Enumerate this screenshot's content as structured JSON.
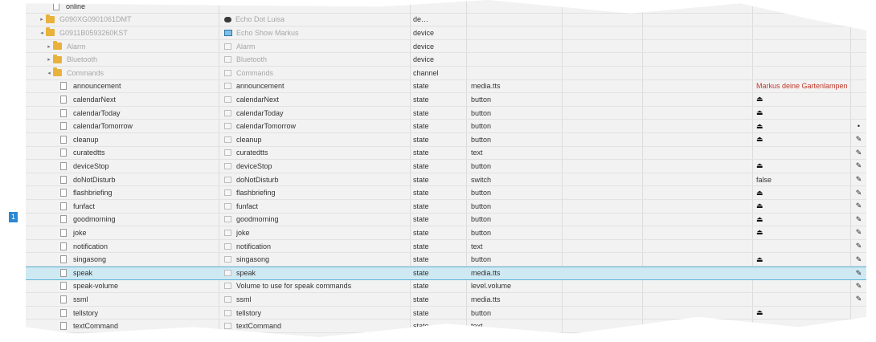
{
  "pagination": {
    "current_page": "1"
  },
  "rows": [
    {
      "indent": 2,
      "toggle": "",
      "icon": "file",
      "id": "online",
      "name": "",
      "type": "",
      "role": "",
      "value": "",
      "action": "",
      "dim": false
    },
    {
      "indent": 1,
      "toggle": "▸",
      "icon": "folder",
      "id": "G090XG0901061DMT",
      "name": "Echo Dot Luisa",
      "name_icon": "echo-dot",
      "type": "de…",
      "role": "",
      "value": "",
      "action": "",
      "dim": true
    },
    {
      "indent": 1,
      "toggle": "◂",
      "icon": "folder",
      "id": "G0911B0593260KST",
      "name": "Echo Show Markus",
      "name_icon": "echo-show",
      "type": "device",
      "role": "",
      "value": "",
      "action": "",
      "dim": true
    },
    {
      "indent": 2,
      "toggle": "▸",
      "icon": "folder",
      "id": "Alarm",
      "name": "Alarm",
      "name_icon": "obj",
      "type": "device",
      "role": "",
      "value": "",
      "action": "",
      "dim": true
    },
    {
      "indent": 2,
      "toggle": "▸",
      "icon": "folder",
      "id": "Bluetooth",
      "name": "Bluetooth",
      "name_icon": "obj",
      "type": "device",
      "role": "",
      "value": "",
      "action": "",
      "dim": true
    },
    {
      "indent": 2,
      "toggle": "◂",
      "icon": "folder",
      "id": "Commands",
      "name": "Commands",
      "name_icon": "obj",
      "type": "channel",
      "role": "",
      "value": "",
      "action": "",
      "dim": true
    },
    {
      "indent": 3,
      "toggle": "",
      "icon": "file",
      "id": "announcement",
      "name": "announcement",
      "name_icon": "obj",
      "type": "state",
      "role": "media.tts",
      "value": "Markus deine Gartenlampen",
      "value_style": "red",
      "action": "",
      "dim": false
    },
    {
      "indent": 3,
      "toggle": "",
      "icon": "file",
      "id": "calendarNext",
      "name": "calendarNext",
      "name_icon": "obj",
      "type": "state",
      "role": "button",
      "value": "⏏",
      "value_style": "eject",
      "action": "",
      "dim": false
    },
    {
      "indent": 3,
      "toggle": "",
      "icon": "file",
      "id": "calendarToday",
      "name": "calendarToday",
      "name_icon": "obj",
      "type": "state",
      "role": "button",
      "value": "⏏",
      "value_style": "eject",
      "action": "",
      "dim": false
    },
    {
      "indent": 3,
      "toggle": "",
      "icon": "file",
      "id": "calendarTomorrow",
      "name": "calendarTomorrow",
      "name_icon": "obj",
      "type": "state",
      "role": "button",
      "value": "⏏",
      "value_style": "eject",
      "action": "•",
      "dim": false
    },
    {
      "indent": 3,
      "toggle": "",
      "icon": "file",
      "id": "cleanup",
      "name": "cleanup",
      "name_icon": "obj",
      "type": "state",
      "role": "button",
      "value": "⏏",
      "value_style": "eject",
      "action": "✎",
      "dim": false
    },
    {
      "indent": 3,
      "toggle": "",
      "icon": "file",
      "id": "curatedtts",
      "name": "curatedtts",
      "name_icon": "obj",
      "type": "state",
      "role": "text",
      "value": "",
      "action": "✎",
      "dim": false
    },
    {
      "indent": 3,
      "toggle": "",
      "icon": "file",
      "id": "deviceStop",
      "name": "deviceStop",
      "name_icon": "obj",
      "type": "state",
      "role": "button",
      "value": "⏏",
      "value_style": "eject",
      "action": "✎",
      "dim": false
    },
    {
      "indent": 3,
      "toggle": "",
      "icon": "file",
      "id": "doNotDisturb",
      "name": "doNotDisturb",
      "name_icon": "obj",
      "type": "state",
      "role": "switch",
      "value": "false",
      "action": "✎",
      "dim": false
    },
    {
      "indent": 3,
      "toggle": "",
      "icon": "file",
      "id": "flashbriefing",
      "name": "flashbriefing",
      "name_icon": "obj",
      "type": "state",
      "role": "button",
      "value": "⏏",
      "value_style": "eject",
      "action": "✎",
      "dim": false
    },
    {
      "indent": 3,
      "toggle": "",
      "icon": "file",
      "id": "funfact",
      "name": "funfact",
      "name_icon": "obj",
      "type": "state",
      "role": "button",
      "value": "⏏",
      "value_style": "eject",
      "action": "✎",
      "dim": false
    },
    {
      "indent": 3,
      "toggle": "",
      "icon": "file",
      "id": "goodmorning",
      "name": "goodmorning",
      "name_icon": "obj",
      "type": "state",
      "role": "button",
      "value": "⏏",
      "value_style": "eject",
      "action": "✎",
      "dim": false
    },
    {
      "indent": 3,
      "toggle": "",
      "icon": "file",
      "id": "joke",
      "name": "joke",
      "name_icon": "obj",
      "type": "state",
      "role": "button",
      "value": "⏏",
      "value_style": "eject",
      "action": "✎",
      "dim": false
    },
    {
      "indent": 3,
      "toggle": "",
      "icon": "file",
      "id": "notification",
      "name": "notification",
      "name_icon": "obj",
      "type": "state",
      "role": "text",
      "value": "",
      "action": "✎",
      "dim": false
    },
    {
      "indent": 3,
      "toggle": "",
      "icon": "file",
      "id": "singasong",
      "name": "singasong",
      "name_icon": "obj",
      "type": "state",
      "role": "button",
      "value": "⏏",
      "value_style": "eject",
      "action": "✎",
      "dim": false
    },
    {
      "indent": 3,
      "toggle": "",
      "icon": "file",
      "id": "speak",
      "name": "speak",
      "name_icon": "obj",
      "type": "state",
      "role": "media.tts",
      "value": "",
      "action": "✎",
      "dim": false,
      "selected": true
    },
    {
      "indent": 3,
      "toggle": "",
      "icon": "file",
      "id": "speak-volume",
      "name": "Volume to use for speak commands",
      "name_icon": "obj",
      "type": "state",
      "role": "level.volume",
      "value": "",
      "action": "✎",
      "dim": false
    },
    {
      "indent": 3,
      "toggle": "",
      "icon": "file",
      "id": "ssml",
      "name": "ssml",
      "name_icon": "obj",
      "type": "state",
      "role": "media.tts",
      "value": "",
      "action": "✎",
      "dim": false
    },
    {
      "indent": 3,
      "toggle": "",
      "icon": "file",
      "id": "tellstory",
      "name": "tellstory",
      "name_icon": "obj",
      "type": "state",
      "role": "button",
      "value": "⏏",
      "value_style": "eject",
      "action": "",
      "dim": false
    },
    {
      "indent": 3,
      "toggle": "",
      "icon": "file",
      "id": "textCommand",
      "name": "textCommand",
      "name_icon": "obj",
      "type": "state",
      "role": "text",
      "value": "",
      "action": "",
      "dim": false
    }
  ],
  "icons": {
    "folder": "folder-icon",
    "file": "file-icon",
    "eject": "eject-icon",
    "pencil": "pencil-edit-icon",
    "echo-dot": "echo-dot-icon",
    "echo-show": "echo-show-icon"
  },
  "colors": {
    "selected_row": "#cfe9f3",
    "value_red": "#c0392b",
    "folder": "#e8b23c",
    "page_badge": "#2b87d1"
  }
}
